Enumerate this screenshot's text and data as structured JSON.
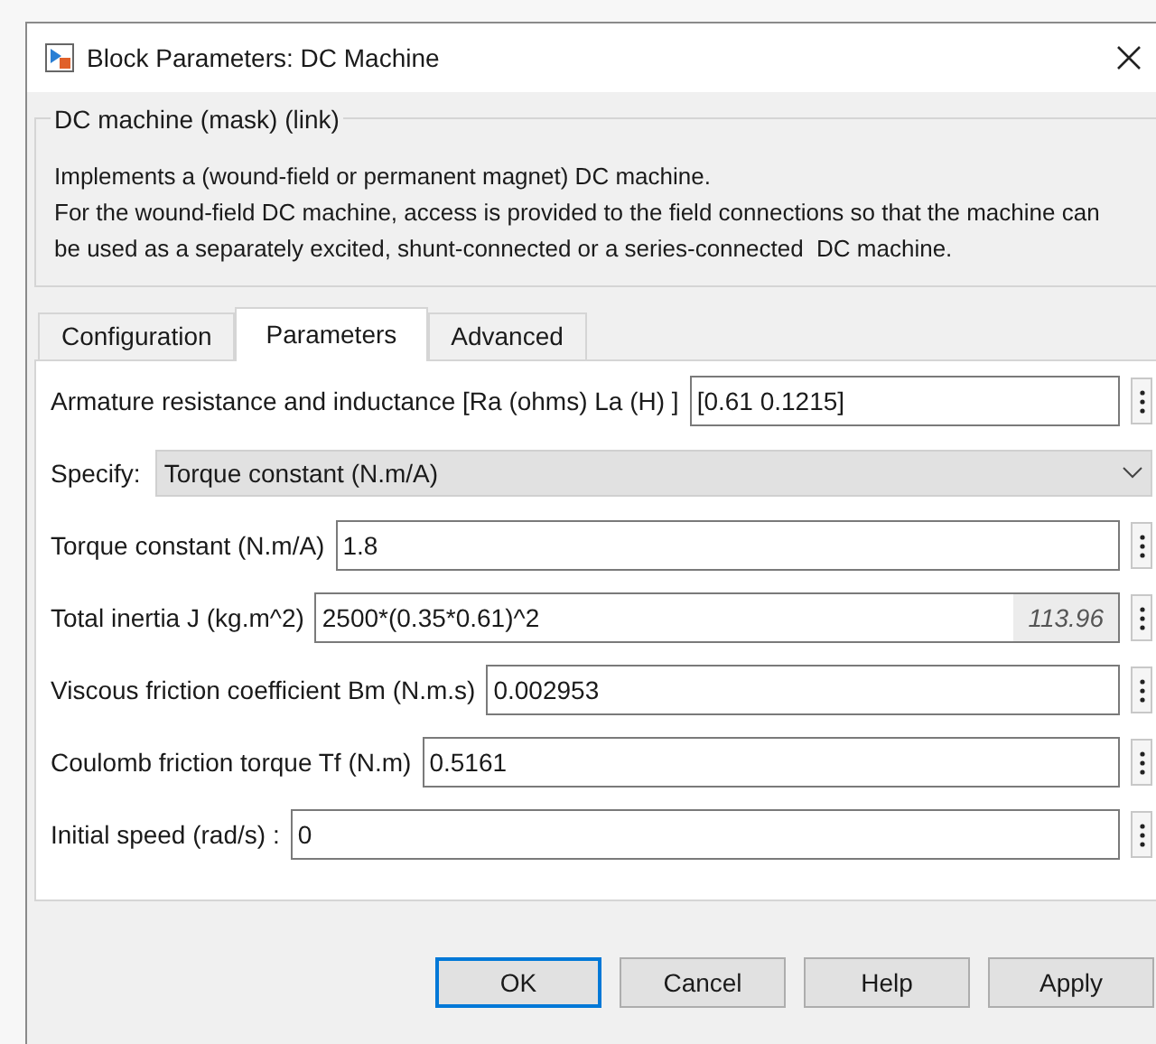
{
  "window": {
    "title": "Block Parameters: DC Machine"
  },
  "group": {
    "title": "DC machine (mask) (link)",
    "description": [
      "Implements a (wound-field or permanent magnet) DC machine.",
      "For the wound-field DC machine, access is provided to the field connections so that the machine can be used as a separately excited, shunt-connected or a series-connected  DC machine."
    ]
  },
  "tabs": [
    {
      "label": "Configuration",
      "selected": false
    },
    {
      "label": "Parameters",
      "selected": true
    },
    {
      "label": "Advanced",
      "selected": false
    }
  ],
  "parameters": [
    {
      "kind": "text",
      "label": "Armature resistance and inductance [Ra (ohms) La (H) ]",
      "value": "[0.61 0.1215]"
    },
    {
      "kind": "dropdown",
      "label": "Specify:",
      "value": "Torque constant (N.m/A)"
    },
    {
      "kind": "text",
      "label": "Torque constant (N.m/A)",
      "value": "1.8"
    },
    {
      "kind": "text",
      "label": "Total inertia J (kg.m^2)",
      "value": "2500*(0.35*0.61)^2",
      "evaluated": "113.96"
    },
    {
      "kind": "text",
      "label": "Viscous friction coefficient Bm (N.m.s)",
      "value": "0.002953"
    },
    {
      "kind": "text",
      "label": "Coulomb friction torque Tf (N.m)",
      "value": "0.5161"
    },
    {
      "kind": "text",
      "label": "Initial speed (rad/s) :",
      "value": "0"
    }
  ],
  "buttons": [
    {
      "label": "OK",
      "default": true
    },
    {
      "label": "Cancel",
      "default": false
    },
    {
      "label": "Help",
      "default": false
    },
    {
      "label": "Apply",
      "default": false
    }
  ]
}
